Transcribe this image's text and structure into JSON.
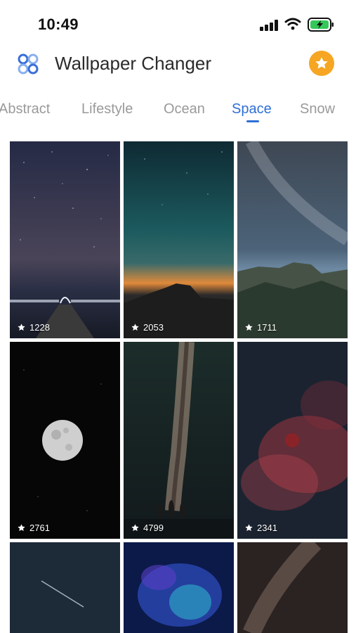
{
  "status_bar": {
    "time": "10:49"
  },
  "header": {
    "title": "Wallpaper Changer"
  },
  "tabs": [
    {
      "label": "Abstract"
    },
    {
      "label": "Lifestyle"
    },
    {
      "label": "Ocean"
    },
    {
      "label": "Space",
      "active": true
    },
    {
      "label": "Snow"
    }
  ],
  "colors": {
    "accent": "#2f6fd6",
    "star_button": "#f6a623",
    "inactive_tab": "#9a9a9a"
  },
  "wallpapers": [
    {
      "subject": "starry night pier",
      "rating": "1228"
    },
    {
      "subject": "half dome sunset",
      "rating": "2053"
    },
    {
      "subject": "milky way over valley",
      "rating": "1711"
    },
    {
      "subject": "full moon",
      "rating": "2761"
    },
    {
      "subject": "milky way with people",
      "rating": "4799"
    },
    {
      "subject": "red moon nebula",
      "rating": "2341"
    },
    {
      "subject": "shooting star",
      "rating": ""
    },
    {
      "subject": "blue nebula",
      "rating": ""
    },
    {
      "subject": "milky way rocks",
      "rating": ""
    }
  ]
}
